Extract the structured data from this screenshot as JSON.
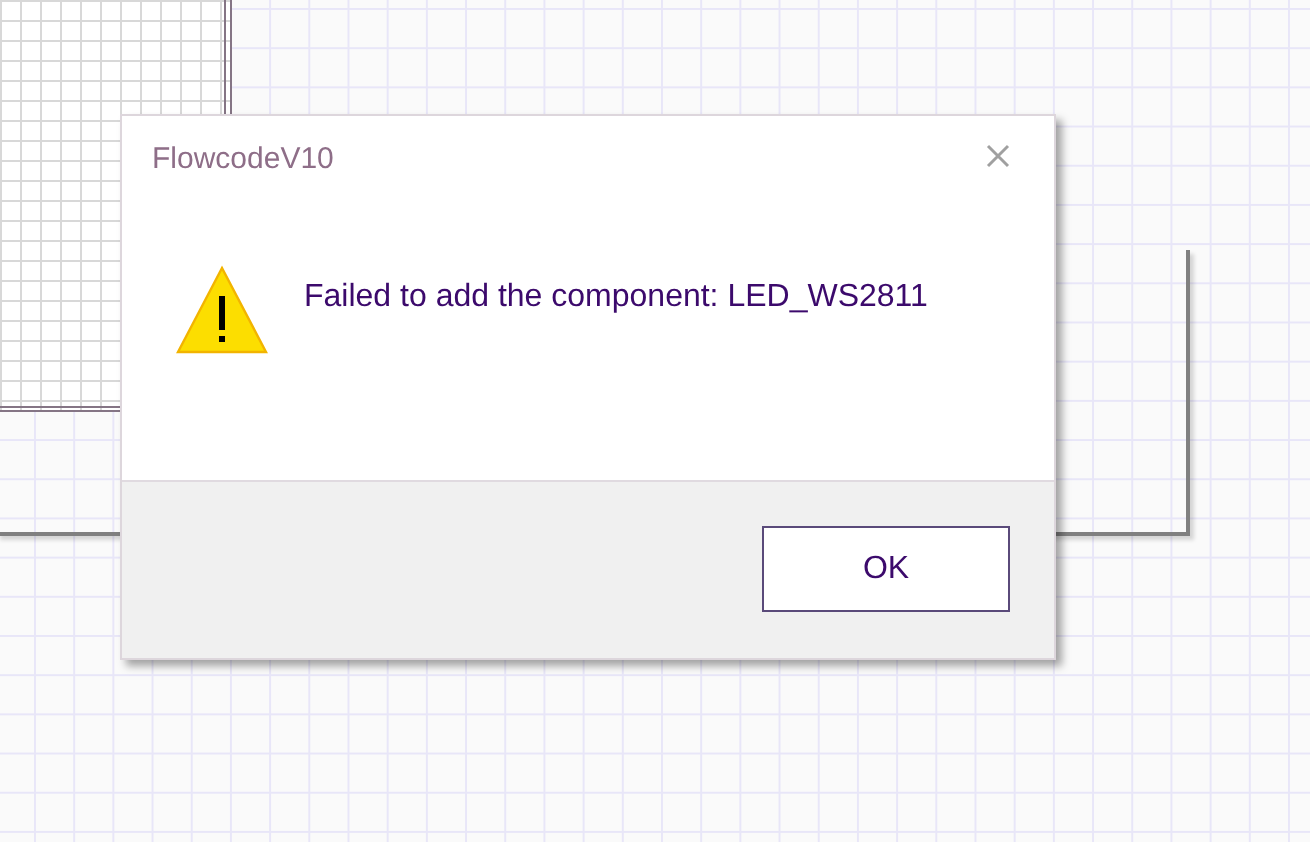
{
  "dialog": {
    "title": "FlowcodeV10",
    "message": "Failed to add the component: LED_WS2811",
    "buttons": [
      {
        "label": "OK"
      }
    ]
  }
}
